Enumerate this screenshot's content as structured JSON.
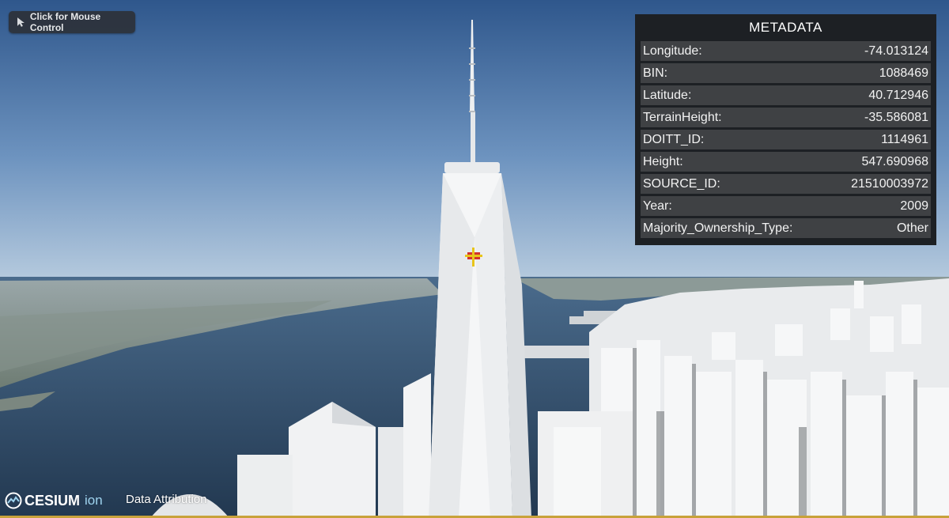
{
  "mouse_control": {
    "label": "Click for Mouse Control"
  },
  "metadata_panel": {
    "title": "METADATA",
    "rows": [
      {
        "key": "Longitude:",
        "value": "-74.013124"
      },
      {
        "key": "BIN:",
        "value": "1088469"
      },
      {
        "key": "Latitude:",
        "value": "40.712946"
      },
      {
        "key": "TerrainHeight:",
        "value": "-35.586081"
      },
      {
        "key": "DOITT_ID:",
        "value": "1114961"
      },
      {
        "key": "Height:",
        "value": "547.690968"
      },
      {
        "key": "SOURCE_ID:",
        "value": "21510003972"
      },
      {
        "key": "Year:",
        "value": "2009"
      },
      {
        "key": "Majority_Ownership_Type:",
        "value": "Other"
      }
    ]
  },
  "footer": {
    "logo_text": "CESIUM",
    "logo_suffix": "ion",
    "attribution_label": "Data Attribution"
  },
  "colors": {
    "panel_bg": "#1d2024",
    "row_bg": "#3f4144",
    "selection_marker": "#e8c51a",
    "selection_highlight": "#d2322c"
  }
}
